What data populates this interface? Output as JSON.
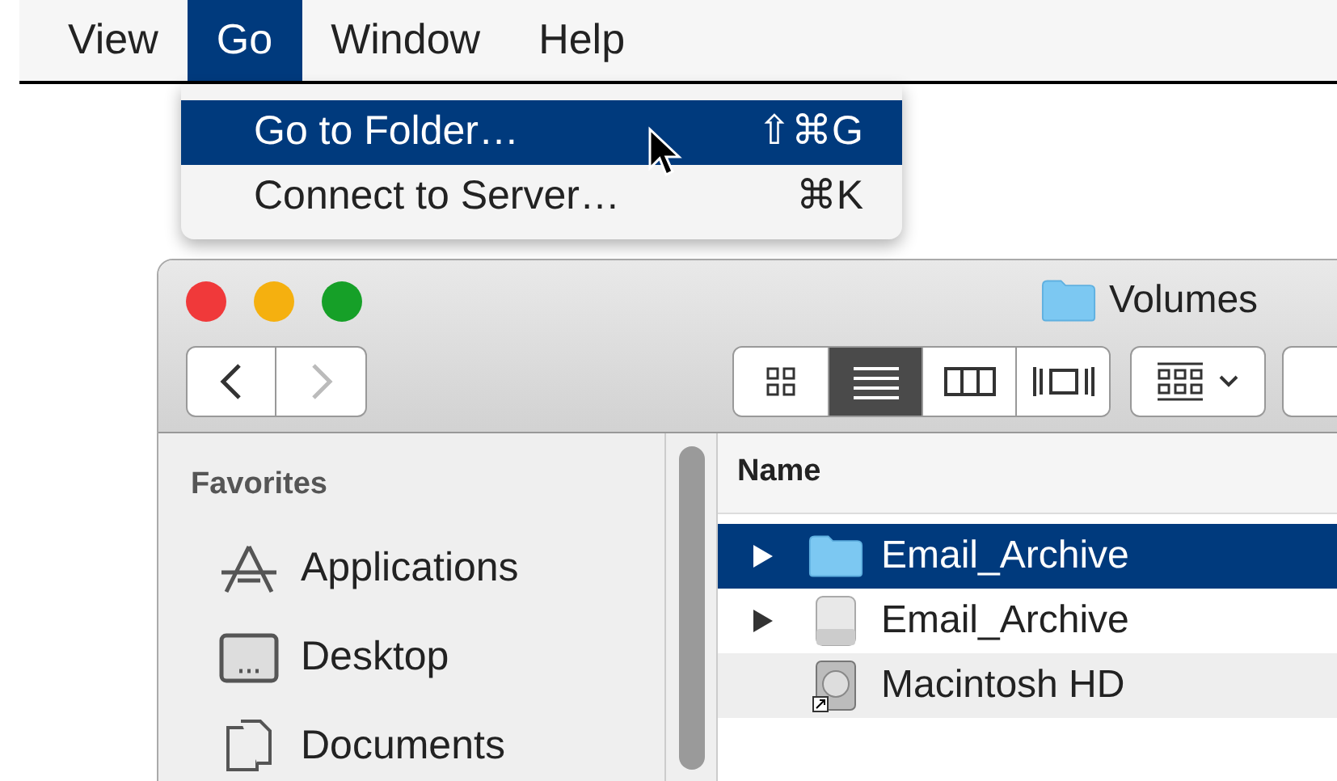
{
  "menubar": {
    "items": [
      {
        "label": "View",
        "selected": false
      },
      {
        "label": "Go",
        "selected": true
      },
      {
        "label": "Window",
        "selected": false
      },
      {
        "label": "Help",
        "selected": false
      }
    ]
  },
  "menu": {
    "items": [
      {
        "label": "Go to Folder…",
        "shortcut": "⇧⌘G",
        "selected": true
      },
      {
        "label": "Connect to Server…",
        "shortcut": "⌘K",
        "selected": false
      }
    ]
  },
  "window": {
    "title": "Volumes",
    "view_buttons": [
      {
        "kind": "icons",
        "selected": false
      },
      {
        "kind": "list",
        "selected": true
      },
      {
        "kind": "columns",
        "selected": false
      },
      {
        "kind": "coverflow",
        "selected": false
      }
    ]
  },
  "sidebar": {
    "heading": "Favorites",
    "items": [
      {
        "label": "Applications",
        "kind": "applications"
      },
      {
        "label": "Desktop",
        "kind": "desktop"
      },
      {
        "label": "Documents",
        "kind": "documents"
      }
    ]
  },
  "table": {
    "column": "Name",
    "rows": [
      {
        "name": "Email_Archive",
        "kind": "folder",
        "expandable": true,
        "selected": true
      },
      {
        "name": "Email_Archive",
        "kind": "drive",
        "expandable": true,
        "selected": false
      },
      {
        "name": "Macintosh HD",
        "kind": "disk",
        "expandable": false,
        "selected": false
      }
    ]
  }
}
